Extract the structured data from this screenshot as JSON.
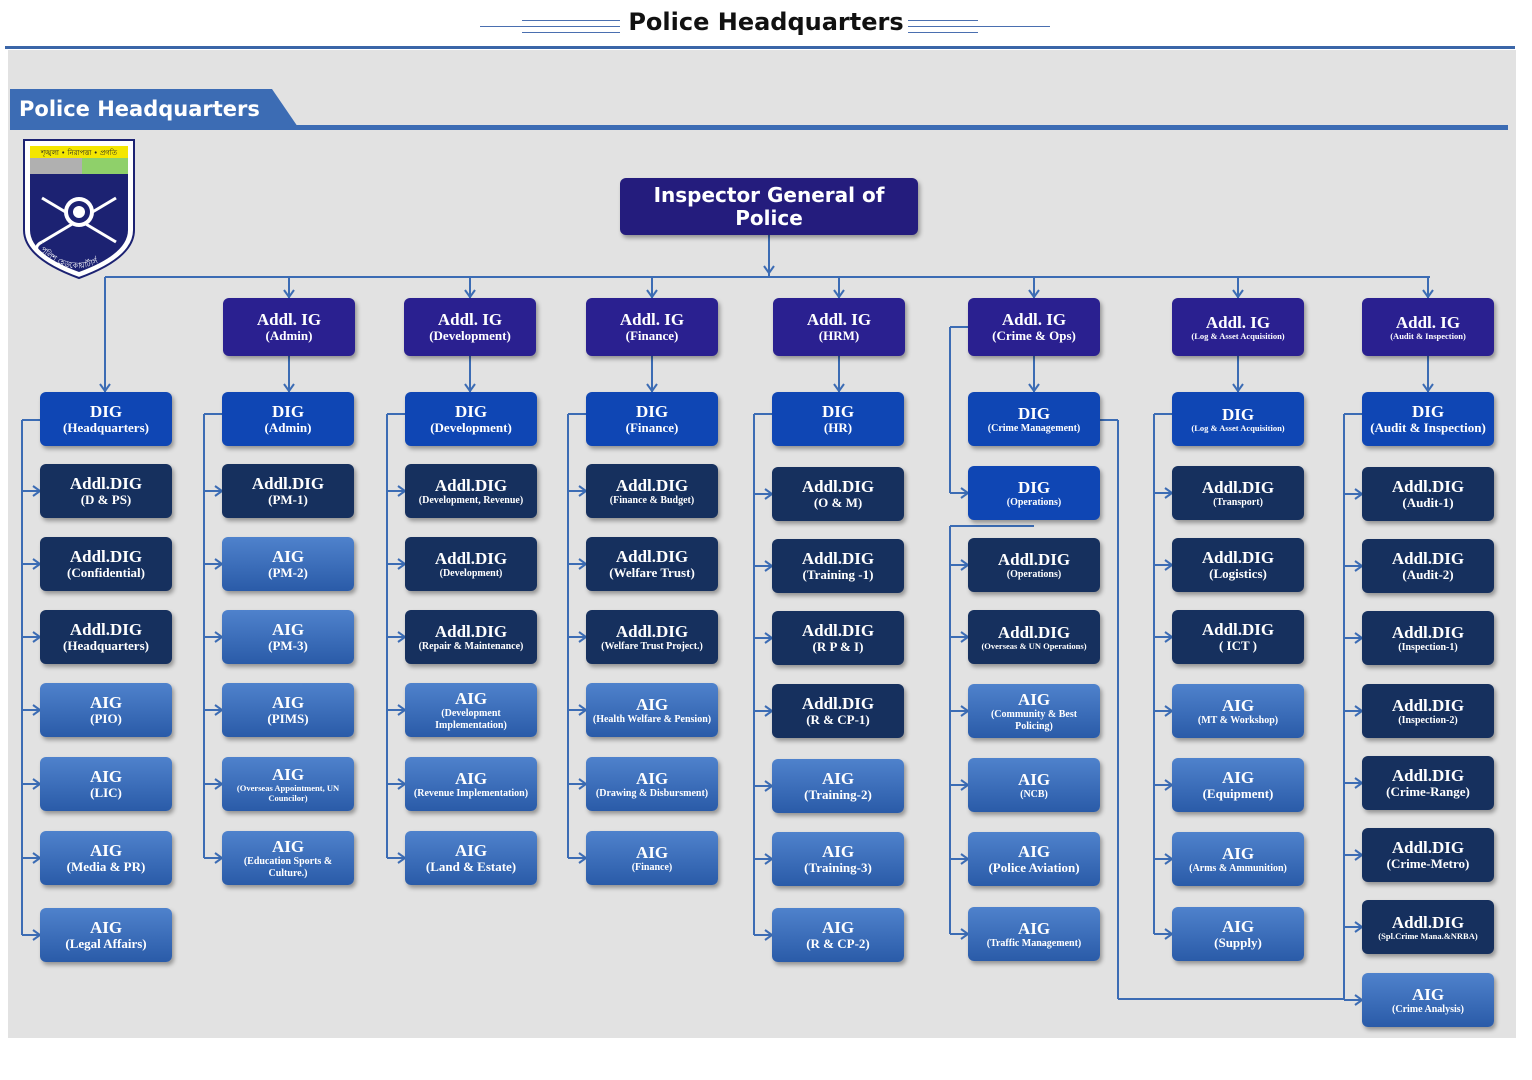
{
  "page_title": "Police Headquarters",
  "section_title": "Police Headquarters",
  "emblem": {
    "band_text": "শৃঙ্খলা • নিরাপত্তা • প্রগতি",
    "ring_text": "পুলিশ হেডকোয়ার্টার্স"
  },
  "root": {
    "title": "Inspector General of Police"
  },
  "columns": [
    {
      "head": null,
      "nodes": [
        {
          "t": "DIG",
          "s": "(Headquarters)",
          "k": "dig"
        },
        {
          "t": "Addl.DIG",
          "s": "(D & PS)",
          "k": "adig"
        },
        {
          "t": "Addl.DIG",
          "s": "(Confidential)",
          "k": "adig"
        },
        {
          "t": "Addl.DIG",
          "s": "(Headquarters)",
          "k": "adig"
        },
        {
          "t": "AIG",
          "s": "(PIO)",
          "k": "aig"
        },
        {
          "t": "AIG",
          "s": "(LIC)",
          "k": "aig"
        },
        {
          "t": "AIG",
          "s": "(Media & PR)",
          "k": "aig"
        },
        {
          "t": "AIG",
          "s": "(Legal Affairs)",
          "k": "aig"
        }
      ]
    },
    {
      "head": {
        "t": "Addl. IG",
        "s": "(Admin)"
      },
      "nodes": [
        {
          "t": "DIG",
          "s": "(Admin)",
          "k": "dig"
        },
        {
          "t": "Addl.DIG",
          "s": "(PM-1)",
          "k": "adig"
        },
        {
          "t": "AIG",
          "s": "(PM-2)",
          "k": "aig"
        },
        {
          "t": "AIG",
          "s": "(PM-3)",
          "k": "aig"
        },
        {
          "t": "AIG",
          "s": "(PIMS)",
          "k": "aig"
        },
        {
          "t": "AIG",
          "s": "(Overseas Appointment, UN Councilor)",
          "k": "aig",
          "z": "xsmall"
        },
        {
          "t": "AIG",
          "s": "(Education Sports & Culture.)",
          "k": "aig",
          "z": "small"
        }
      ]
    },
    {
      "head": {
        "t": "Addl. IG",
        "s": "(Development)"
      },
      "nodes": [
        {
          "t": "DIG",
          "s": "(Development)",
          "k": "dig"
        },
        {
          "t": "Addl.DIG",
          "s": "(Development, Revenue)",
          "k": "adig",
          "z": "small"
        },
        {
          "t": "Addl.DIG",
          "s": "(Development)",
          "k": "adig",
          "z": "small"
        },
        {
          "t": "Addl.DIG",
          "s": "(Repair & Maintenance)",
          "k": "adig",
          "z": "small"
        },
        {
          "t": "AIG",
          "s": "(Development Implementation)",
          "k": "aig",
          "z": "small"
        },
        {
          "t": "AIG",
          "s": "(Revenue Implementation)",
          "k": "aig",
          "z": "small"
        },
        {
          "t": "AIG",
          "s": "(Land & Estate)",
          "k": "aig"
        }
      ]
    },
    {
      "head": {
        "t": "Addl. IG",
        "s": "(Finance)"
      },
      "nodes": [
        {
          "t": "DIG",
          "s": "(Finance)",
          "k": "dig"
        },
        {
          "t": "Addl.DIG",
          "s": "(Finance & Budget)",
          "k": "adig",
          "z": "small"
        },
        {
          "t": "Addl.DIG",
          "s": "(Welfare Trust)",
          "k": "adig"
        },
        {
          "t": "Addl.DIG",
          "s": "(Welfare Trust Project.)",
          "k": "adig",
          "z": "small"
        },
        {
          "t": "AIG",
          "s": "(Health Welfare & Pension)",
          "k": "aig",
          "z": "small"
        },
        {
          "t": "AIG",
          "s": "(Drawing & Disbursment)",
          "k": "aig",
          "z": "small"
        },
        {
          "t": "AIG",
          "s": "(Finance)",
          "k": "aig",
          "z": "small"
        }
      ]
    },
    {
      "head": {
        "t": "Addl. IG",
        "s": "(HRM)"
      },
      "nodes": [
        {
          "t": "DIG",
          "s": "(HR)",
          "k": "dig"
        },
        {
          "t": "Addl.DIG",
          "s": "(O & M)",
          "k": "adig"
        },
        {
          "t": "Addl.DIG",
          "s": "(Training -1)",
          "k": "adig"
        },
        {
          "t": "Addl.DIG",
          "s": "(R P & I)",
          "k": "adig"
        },
        {
          "t": "Addl.DIG",
          "s": "(R & CP-1)",
          "k": "adig"
        },
        {
          "t": "AIG",
          "s": "(Training-2)",
          "k": "aig"
        },
        {
          "t": "AIG",
          "s": "(Training-3)",
          "k": "aig"
        },
        {
          "t": "AIG",
          "s": "(R & CP-2)",
          "k": "aig"
        }
      ]
    },
    {
      "head": {
        "t": "Addl. IG",
        "s": "(Crime & Ops)"
      },
      "nodes": [
        {
          "t": "DIG",
          "s": "(Crime Management)",
          "k": "dig",
          "z": "small"
        },
        {
          "t": "DIG",
          "s": "(Operations)",
          "k": "dig",
          "z": "small"
        },
        {
          "t": "Addl.DIG",
          "s": "(Operations)",
          "k": "adig",
          "z": "small"
        },
        {
          "t": "Addl.DIG",
          "s": "(Overseas & UN Operations)",
          "k": "adig",
          "z": "xsmall"
        },
        {
          "t": "AIG",
          "s": "(Community & Best Policing)",
          "k": "aig",
          "z": "small"
        },
        {
          "t": "AIG",
          "s": "(NCB)",
          "k": "aig",
          "z": "small"
        },
        {
          "t": "AIG",
          "s": "(Police Aviation)",
          "k": "aig"
        },
        {
          "t": "AIG",
          "s": "(Traffic Management)",
          "k": "aig",
          "z": "small"
        }
      ]
    },
    {
      "head": {
        "t": "Addl. IG",
        "s": "(Log & Asset Acquisition)"
      },
      "nodes": [
        {
          "t": "DIG",
          "s": "(Log & Asset Acquisition)",
          "k": "dig",
          "z": "xsmall"
        },
        {
          "t": "Addl.DIG",
          "s": "(Transport)",
          "k": "adig",
          "z": "small"
        },
        {
          "t": "Addl.DIG",
          "s": "(Logistics)",
          "k": "adig"
        },
        {
          "t": "Addl.DIG",
          "s": "( ICT )",
          "k": "adig"
        },
        {
          "t": "AIG",
          "s": "(MT & Workshop)",
          "k": "aig",
          "z": "small"
        },
        {
          "t": "AIG",
          "s": "(Equipment)",
          "k": "aig"
        },
        {
          "t": "AIG",
          "s": "(Arms & Ammunition)",
          "k": "aig",
          "z": "small"
        },
        {
          "t": "AIG",
          "s": "(Supply)",
          "k": "aig"
        }
      ]
    },
    {
      "head": {
        "t": "Addl. IG",
        "s": "(Audit & Inspection)"
      },
      "nodes": [
        {
          "t": "DIG",
          "s": "(Audit & Inspection)",
          "k": "dig"
        },
        {
          "t": "Addl.DIG",
          "s": "(Audit-1)",
          "k": "adig"
        },
        {
          "t": "Addl.DIG",
          "s": "(Audit-2)",
          "k": "adig"
        },
        {
          "t": "Addl.DIG",
          "s": "(Inspection-1)",
          "k": "adig",
          "z": "small"
        },
        {
          "t": "Addl.DIG",
          "s": "(Inspection-2)",
          "k": "adig",
          "z": "small"
        },
        {
          "t": "Addl.DIG",
          "s": "(Crime-Range)",
          "k": "adig"
        },
        {
          "t": "Addl.DIG",
          "s": "(Crime-Metro)",
          "k": "adig"
        },
        {
          "t": "Addl.DIG",
          "s": "(Spl.Crime Mana.&NRBA)",
          "k": "adig",
          "z": "xsmall"
        },
        {
          "t": "AIG",
          "s": "(Crime Analysis)",
          "k": "aig",
          "z": "small"
        }
      ]
    }
  ],
  "colors": {
    "igp": "#241c7d",
    "addl_ig": "#2a2090",
    "dig": "#0f46b4",
    "addl_dig": "#16305e",
    "aig": "#3a6cbc",
    "connector": "#3c6cb4"
  }
}
